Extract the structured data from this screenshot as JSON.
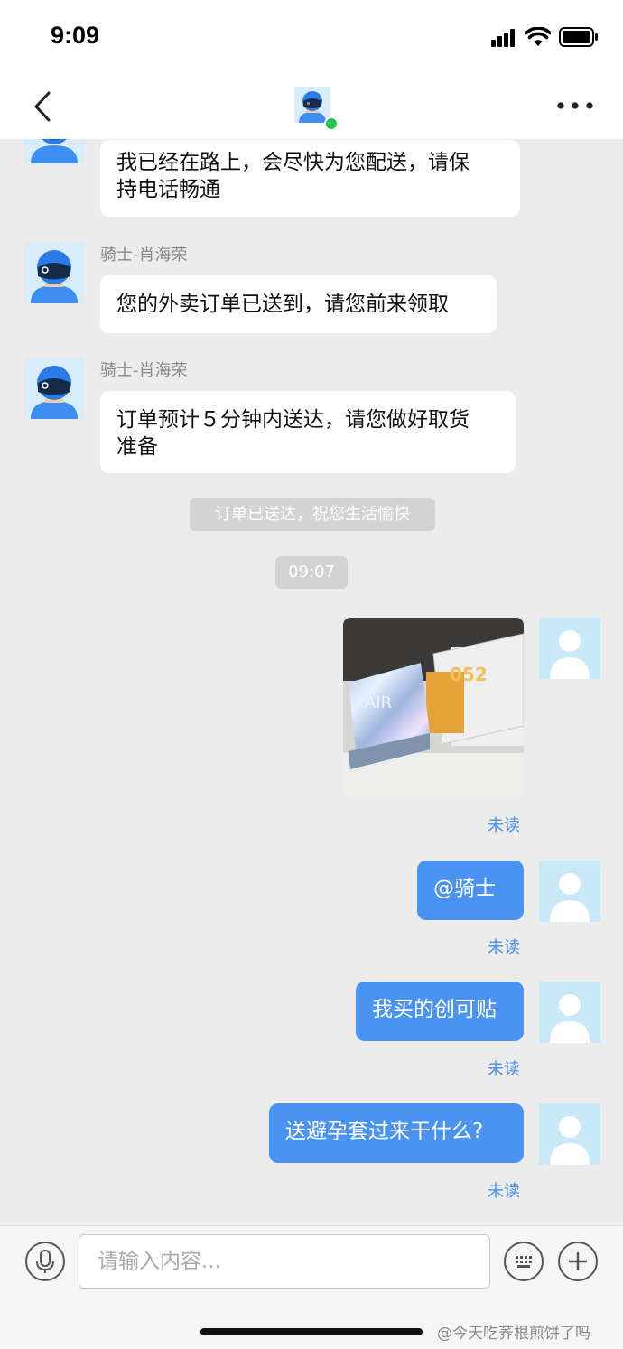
{
  "status_bar": {
    "time": "9:09"
  },
  "header": {
    "contact_online": true
  },
  "messages": [
    {
      "side": "left",
      "text": "我已经在路上，会尽快为您配送，请保持电话畅通",
      "line1": "我已经在路上，会尽快为您配送，请保",
      "line2": "持电话畅通"
    },
    {
      "side": "left",
      "sender": "骑士-肖海荣",
      "text": "您的外卖订单已送到，请您前来领取"
    },
    {
      "side": "left",
      "sender": "骑士-肖海荣",
      "text": "订单预计５分钟内送达，请您做好取货准备",
      "line1": "订单预计５分钟内送达，请您做好取货",
      "line2": "准备"
    },
    {
      "type": "system",
      "text": "订单已送达，祝您生活愉快"
    },
    {
      "type": "timestamp",
      "text": "09:07"
    },
    {
      "side": "right",
      "type": "image",
      "image_desc": "boxes-photo",
      "status": "未读"
    },
    {
      "side": "right",
      "text": "@骑士",
      "status": "未读"
    },
    {
      "side": "right",
      "text": "我买的创可贴",
      "status": "未读"
    },
    {
      "side": "right",
      "text": "送避孕套过来干什么?",
      "status": "未读"
    }
  ],
  "input_bar": {
    "placeholder": "请输入内容..."
  },
  "watermark": "@今天吃荞根煎饼了吗",
  "colors": {
    "accent": "#4b93f3",
    "unread": "#4a8ef0",
    "online": "#26c64a"
  }
}
